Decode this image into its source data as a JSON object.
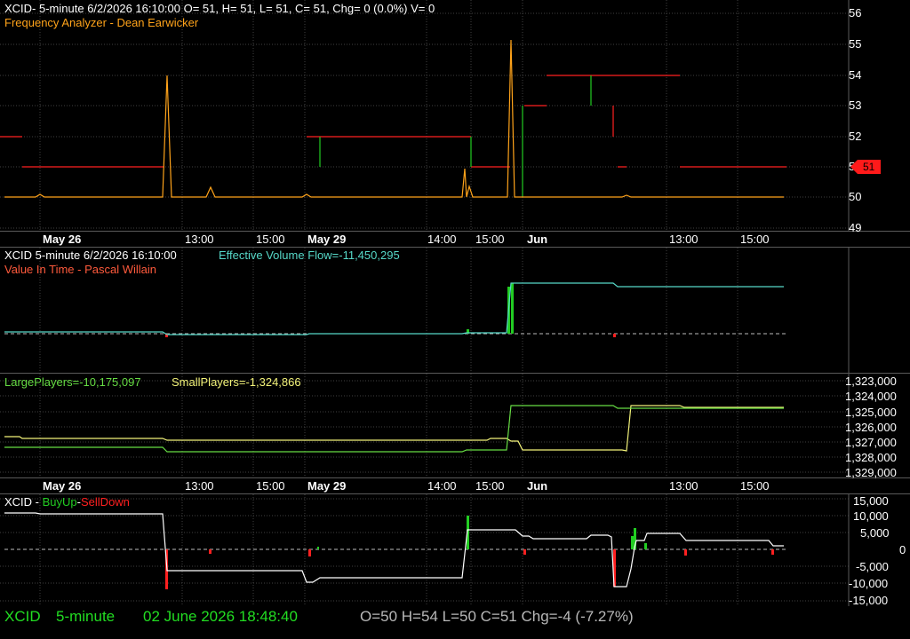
{
  "colors": {
    "background": "#000000",
    "grid": "#404040",
    "title": "#ffffff",
    "orange": "#ffa31a",
    "red": "#ff2020",
    "green": "#22cc22",
    "cyan": "#56d8c8",
    "lightgreen": "#66dd44",
    "yellow": "#f3f37a",
    "status_green": "#22dd22",
    "status_grey": "#b8b8b8"
  },
  "pane1": {
    "title": "XCID- 5-minute 6/2/2026 16:10:00 O= 51, H= 51, L= 51, C= 51, Chg= 0 (0.0%) V= 0",
    "indicator": "Frequency Analyzer - Dean Earwicker",
    "price_scale": [
      "56",
      "55",
      "54",
      "53",
      "52",
      "51",
      "50",
      "49"
    ],
    "last_price": "51"
  },
  "x_axis": {
    "labels": [
      "May 26",
      "13:00",
      "15:00",
      "May 29",
      "14:00",
      "15:00",
      "Jun",
      "13:00",
      "15:00"
    ]
  },
  "pane2": {
    "title": "XCID 5-minute  6/2/2026 16:10:00",
    "evf_label": "Effective Volume Flow=-11,450,295",
    "indicator": "Value In Time - Pascal Willain"
  },
  "pane3": {
    "large_label": "LargePlayers=-10,175,097",
    "small_label": "SmallPlayers=-1,324,866",
    "scale": [
      "1,323,000",
      "1,324,000",
      "1,325,000",
      "1,326,000",
      "1,327,000",
      "1,328,000",
      "1,329,000"
    ]
  },
  "pane4": {
    "title_prefix": "XCID - ",
    "buyup": "BuyUp",
    "dash": "-",
    "selldown": "SellDown",
    "scale": [
      "15,000",
      "10,000",
      "5,000",
      "0",
      "-5,000",
      "-10,000",
      "-15,000"
    ]
  },
  "status": {
    "symbol": "XCID",
    "interval": "5-minute",
    "datetime": "02 June 2026 18:48:40",
    "ohlc": "O=50  H=54  L=50  C=51  Chg=-4 (-7.27%)"
  }
}
